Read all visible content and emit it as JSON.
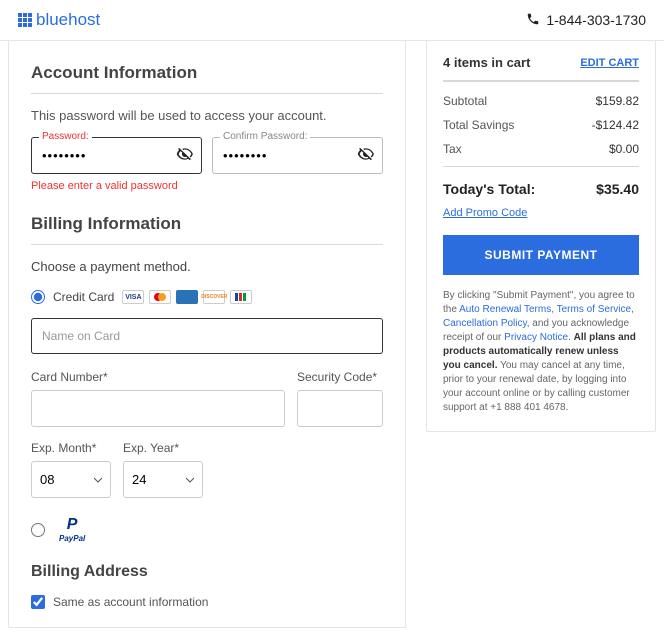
{
  "header": {
    "brand": "bluehost",
    "phone": "1-844-303-1730"
  },
  "account": {
    "heading": "Account Information",
    "helper": "This password will be used to access your account.",
    "password_label": "Password:",
    "password_value": "········",
    "confirm_label": "Confirm Password:",
    "confirm_value": "········",
    "error": "Please enter a valid password"
  },
  "billing": {
    "heading": "Billing Information",
    "choose": "Choose a payment method.",
    "credit_label": "Credit Card",
    "name_placeholder": "Name on Card",
    "card_number_label": "Card Number*",
    "security_label": "Security Code*",
    "exp_month_label": "Exp. Month*",
    "exp_year_label": "Exp. Year*",
    "exp_month_value": "08",
    "exp_year_value": "24",
    "paypal": "PayPal",
    "billing_address_heading": "Billing Address",
    "same_label": "Same as account information"
  },
  "cart": {
    "items_text": "4 items in cart",
    "edit": "EDIT CART",
    "subtotal_label": "Subtotal",
    "subtotal": "$159.82",
    "savings_label": "Total Savings",
    "savings": "-$124.42",
    "tax_label": "Tax",
    "tax": "$0.00",
    "today_label": "Today's Total:",
    "today": "$35.40",
    "promo": "Add Promo Code",
    "submit": "SUBMIT PAYMENT",
    "legal_pre": "By clicking \"Submit Payment\", you agree to the ",
    "auto_renewal": "Auto Renewal Terms",
    "tos": "Terms of Service",
    "cancel_policy": "Cancellation Policy",
    "ack": ", and you acknowledge receipt of our ",
    "privacy": "Privacy Notice",
    "bold1": "All plans and products automatically renew unless you cancel.",
    "rest": " You may cancel at any time, prior to your renewal date, by logging into your account online or by calling customer support at +1 888 401 4678."
  }
}
